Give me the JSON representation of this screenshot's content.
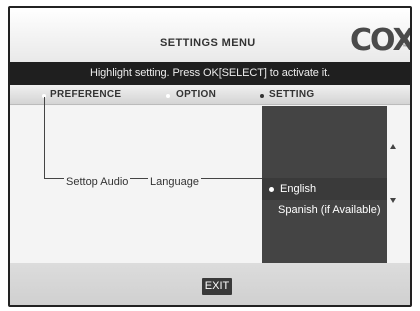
{
  "header": {
    "title": "SETTINGS MENU",
    "logo": "COX",
    "logo_tm": "™"
  },
  "instruction": "Highlight setting.  Press OK[SELECT] to activate it.",
  "columns": {
    "preference": "PREFERENCE",
    "option": "OPTION",
    "setting": "SETTING"
  },
  "row": {
    "preference": "Settop Audio",
    "option": "Language"
  },
  "settings": {
    "options": [
      "English",
      "Spanish (if Available)"
    ],
    "selected": "English"
  },
  "footer": {
    "exit_label": "EXIT"
  },
  "colors": {
    "instruction_bar": "#1f1f1f",
    "setting_panel": "#444444",
    "background": "#f2f2f2"
  }
}
